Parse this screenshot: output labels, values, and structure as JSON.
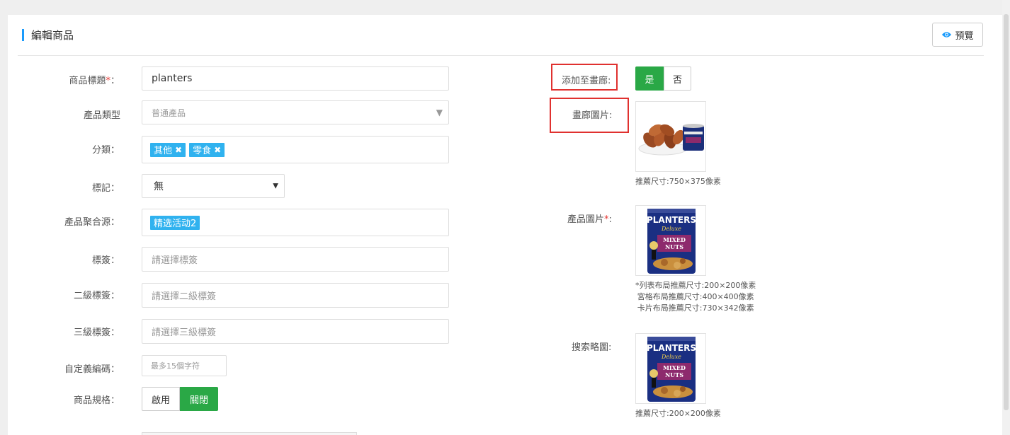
{
  "header": {
    "title": "編輯商品",
    "preview_label": "預覽"
  },
  "form": {
    "title": {
      "label": "商品標題",
      "required_mark": "*",
      "colon": "：",
      "value": "planters"
    },
    "product_type": {
      "label": "產品類型",
      "value": "普通產品"
    },
    "category": {
      "label": "分類：",
      "tags": [
        "其他",
        "零食"
      ],
      "remove_glyph": "✖"
    },
    "mark": {
      "label": "標記：",
      "value": "無"
    },
    "aggregate_source": {
      "label": "產品聚合源：",
      "tag": "精选活动2"
    },
    "tag1": {
      "label": "標簽：",
      "placeholder": "請選擇標簽"
    },
    "tag2": {
      "label": "二級標簽：",
      "placeholder": "請選擇二級標簽"
    },
    "tag3": {
      "label": "三級標簽：",
      "placeholder": "請選擇三級標簽"
    },
    "custom_code": {
      "label": "自定義編碼：",
      "placeholder": "最多15個字符"
    },
    "spec": {
      "label": "商品規格：",
      "options": [
        "啟用",
        "關閉"
      ],
      "selected": "關閉"
    }
  },
  "right": {
    "add_gallery": {
      "label": "添加至畫廊:",
      "options": [
        "是",
        "否"
      ],
      "selected": "是"
    },
    "gallery_image": {
      "label": "畫廊圖片:",
      "hint": "推薦尺寸:750×375像素"
    },
    "product_image": {
      "label": "產品圖片",
      "required_mark": "*",
      "colon": ":",
      "hints": [
        "*列表布局推薦尺寸:200×200像素",
        "宮格布局推薦尺寸:400×400像素",
        "卡片布局推薦尺寸:730×342像素"
      ]
    },
    "search_thumb": {
      "label": "搜索略圖:",
      "hint": "推薦尺寸:200×200像素"
    }
  },
  "can_label": {
    "brand": "PLANTERS",
    "sub": "Deluxe",
    "line1": "MIXED",
    "line2": "NUTS"
  },
  "colors": {
    "accent": "#1a9bfc",
    "tag": "#30b2ef",
    "green": "#2aa846",
    "annotation": "#e0312f"
  }
}
